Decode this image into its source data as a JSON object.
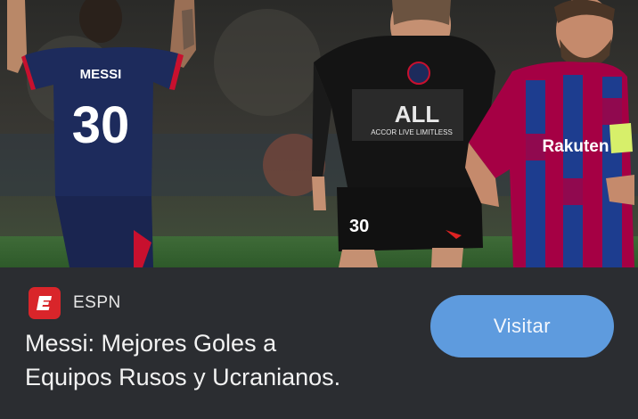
{
  "hero": {
    "left_jersey_name": "MESSI",
    "left_jersey_number": "30",
    "middle_sponsor_logo": "ALL",
    "middle_sponsor_text": "ACCOR LIVE LIMITLESS",
    "middle_short_number": "30",
    "right_sponsor": "Rakuten"
  },
  "source": {
    "name": "ESPN",
    "icon": "espn-logo-icon",
    "brand_color": "#d9252a"
  },
  "headline": {
    "line1": "Messi: Mejores Goles a",
    "line2": "Equipos Rusos y Ucranianos."
  },
  "cta": {
    "label": "Visitar",
    "color": "#5e9bde"
  }
}
